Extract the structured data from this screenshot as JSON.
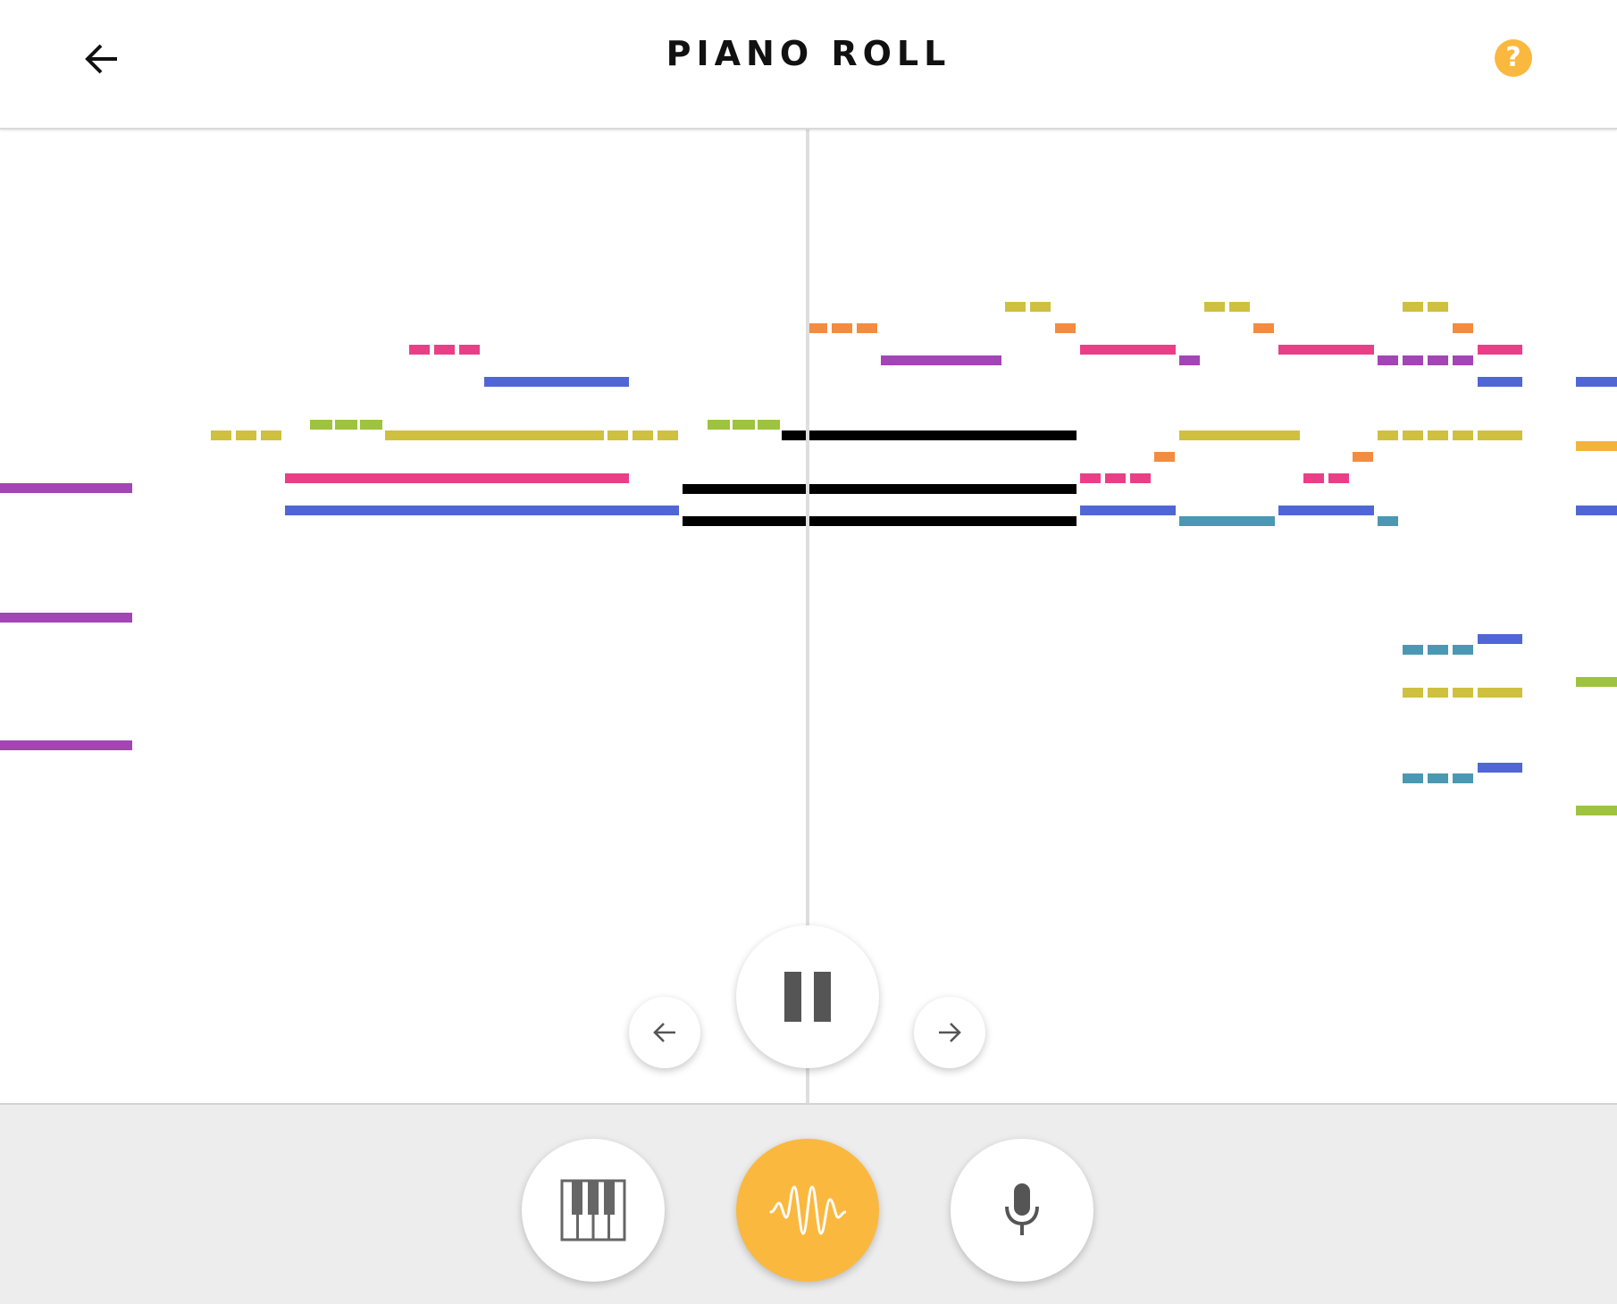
{
  "header": {
    "title": "PIANO ROLL",
    "back_icon": "arrow-left-icon",
    "help_icon": "question-mark-icon",
    "help_label": "?",
    "help_color": "#FBB83F"
  },
  "playback": {
    "pause_icon": "pause-icon",
    "previous_icon": "arrow-left-icon",
    "next_icon": "arrow-right-icon"
  },
  "modes": [
    {
      "name": "piano",
      "icon": "piano-keys-icon",
      "active": false
    },
    {
      "name": "waveform",
      "icon": "waveform-icon",
      "active": true
    },
    {
      "name": "microphone",
      "icon": "microphone-icon",
      "active": false
    }
  ],
  "colors": {
    "accent": "#FBB83F",
    "playing": "#000000",
    "purple": "#A245B5",
    "pink": "#EA3F87",
    "blue": "#5066D6",
    "olive": "#CFC03F",
    "green": "#9DC33F",
    "orange": "#F28C42",
    "teal": "#4B98B3",
    "gold": "#F2B43C"
  }
}
